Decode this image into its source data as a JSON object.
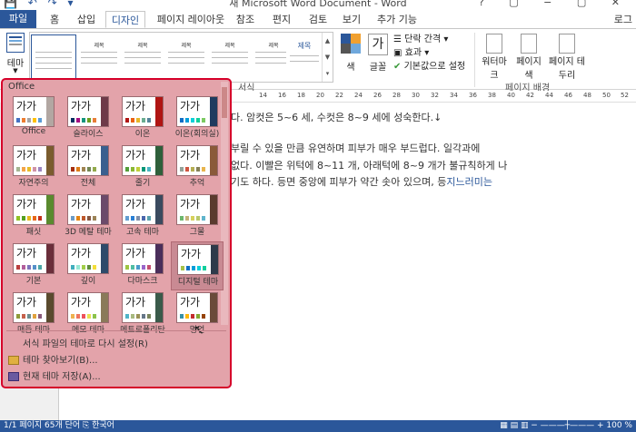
{
  "window": {
    "title": "새 Microsoft Word Document - Word",
    "qat": "💾 ↶ ↷ ▾",
    "controls": "? ▢ − ▢ ✕"
  },
  "tabs": {
    "file": "파일",
    "items": [
      "홈",
      "삽입",
      "디자인",
      "페이지 레이아웃",
      "참조",
      "편지",
      "검토",
      "보기",
      "추가 기능"
    ],
    "active": "디자인",
    "user": "로그"
  },
  "ribbon": {
    "theme_label": "테마",
    "doc_format_label": "서식",
    "style_thumbs": [
      {
        "name": ""
      },
      {
        "name": "제목"
      },
      {
        "name": "제목"
      },
      {
        "name": "제목"
      },
      {
        "name": "제목"
      },
      {
        "name": "제목"
      },
      {
        "name": "제목"
      }
    ],
    "colors_label": "색",
    "fonts_label": "글꼴",
    "paragraph_spacing": "단락 간격 ▾",
    "effects": "효과 ▾",
    "set_default": "기본값으로 설정",
    "watermark": "워터마크",
    "page_color": "페이지 색",
    "page_borders": "페이지 테두리",
    "page_background_label": "페이지 배경"
  },
  "ruler": {
    "numbers": [
      "14",
      "16",
      "18",
      "20",
      "22",
      "24",
      "26",
      "28",
      "30",
      "32",
      "34",
      "36",
      "38",
      "40",
      "42",
      "44",
      "46",
      "48",
      "50",
      "52"
    ]
  },
  "document": {
    "lines": [
      {
        "text": "다. 암컷은 5~6 세, 수컷은 8~9 세에 성숙한다.↓",
        "hl": ""
      },
      {
        "text": "부릴 수 있을 만큼 유연하며 피부가 매우 부드럽다. 일각과에",
        "hl": ""
      },
      {
        "text": "없다. 이빨은 위턱에 8~11 개, 아래턱에 8~9 개가 불규칙하게 나",
        "hl": ""
      },
      {
        "text": "기도 하다. 등면 중앙에 피부가 약간 솟아 있으며, 등",
        "hl": "지느러미는"
      }
    ]
  },
  "theme_panel": {
    "header": "Office",
    "themes": [
      {
        "name": "Office",
        "thumb": "가가",
        "side": "#b2a7a2",
        "colors": [
          "#4472c4",
          "#ed7d31",
          "#a5a5a5",
          "#ffc000",
          "#5b9bd5"
        ]
      },
      {
        "name": "슬라이스",
        "thumb": "가가",
        "side": "#6e3a49",
        "colors": [
          "#052f61",
          "#a50e82",
          "#14967c",
          "#6a9e1f",
          "#e87d37"
        ]
      },
      {
        "name": "이온",
        "thumb": "가가",
        "side": "#b01513",
        "colors": [
          "#b01513",
          "#ea6312",
          "#e6b729",
          "#6aac90",
          "#54849a"
        ]
      },
      {
        "name": "이온(회의실)",
        "thumb": "가가",
        "side": "#1f3a5f",
        "colors": [
          "#0f6fc6",
          "#009dd9",
          "#0bd0d9",
          "#10cf9b",
          "#7cca62"
        ]
      },
      {
        "name": "자연주의",
        "thumb": "가가",
        "side": "#7a5c2e",
        "colors": [
          "#a5b592",
          "#f3a447",
          "#e7bc29",
          "#d092a7",
          "#9c85c0"
        ]
      },
      {
        "name": "전체",
        "thumb": "가가",
        "side": "#3a5f8f",
        "colors": [
          "#a53010",
          "#de7e18",
          "#9f8351",
          "#728653",
          "#92aa4c"
        ]
      },
      {
        "name": "줄기",
        "thumb": "가가",
        "side": "#2e5f3a",
        "colors": [
          "#549e39",
          "#8ab833",
          "#c0cf3a",
          "#029676",
          "#4ab5c4"
        ]
      },
      {
        "name": "추억",
        "thumb": "가가",
        "side": "#8a5a3a",
        "colors": [
          "#93a299",
          "#cf543f",
          "#b5ae53",
          "#848058",
          "#e8b54d"
        ]
      },
      {
        "name": "패싯",
        "thumb": "가가",
        "side": "#5a8a2e",
        "colors": [
          "#90c226",
          "#54a021",
          "#e6b91e",
          "#e76618",
          "#c42f1a"
        ]
      },
      {
        "name": "3D 메탈 테마",
        "thumb": "가가",
        "side": "#6b4a6a",
        "colors": [
          "#6b9bc7",
          "#e48312",
          "#bd582c",
          "#865640",
          "#9b8357"
        ]
      },
      {
        "name": "고속 테마",
        "thumb": "가가",
        "side": "#3a4a5f",
        "colors": [
          "#629dd1",
          "#297fd5",
          "#7f8fa9",
          "#4a66ac",
          "#5aa2ae"
        ]
      },
      {
        "name": "그물",
        "thumb": "가가",
        "side": "#5a3a2e",
        "colors": [
          "#6bb76d",
          "#c6b178",
          "#d6d15c",
          "#b7c86b",
          "#60b5cc"
        ]
      },
      {
        "name": "기본",
        "thumb": "가가",
        "side": "#6a2e3a",
        "colors": [
          "#ba3f3f",
          "#b25e9c",
          "#7e74bc",
          "#5590c9",
          "#4ca6a6"
        ]
      },
      {
        "name": "깊이",
        "thumb": "가가",
        "side": "#2e4a6a",
        "colors": [
          "#41aebd",
          "#97e9d5",
          "#a2cf49",
          "#608f3d",
          "#f4de3a"
        ]
      },
      {
        "name": "다마스크",
        "thumb": "가가",
        "side": "#4a2e5a",
        "colors": [
          "#9ec544",
          "#50bea3",
          "#4a9ccc",
          "#9a66ca",
          "#c54f71"
        ]
      },
      {
        "name": "디지털 테마",
        "thumb": "가가",
        "side": "#2e3a4a",
        "colors": [
          "#a5c249",
          "#0f6fc6",
          "#009dd9",
          "#0bd0d9",
          "#10cf9b"
        ]
      },
      {
        "name": "매듭 테마",
        "thumb": "가가",
        "side": "#5a4a2e",
        "colors": [
          "#8f9a3a",
          "#c5614b",
          "#6b8e8f",
          "#e0a23e",
          "#8a5a7a"
        ]
      },
      {
        "name": "메모 테마",
        "thumb": "가가",
        "side": "#8a7a5a",
        "colors": [
          "#efb251",
          "#ef755f",
          "#ed515c",
          "#e8e152",
          "#8bc34a"
        ]
      },
      {
        "name": "메트로폴리탄",
        "thumb": "가가",
        "side": "#3a5a4a",
        "colors": [
          "#50b4c8",
          "#a8b97f",
          "#9b9256",
          "#657689",
          "#7a855d"
        ]
      },
      {
        "name": "명언",
        "thumb": "가가",
        "side": "#6a4a3a",
        "colors": [
          "#3891a7",
          "#feb80a",
          "#c32d2e",
          "#84aa33",
          "#964305"
        ]
      }
    ],
    "selected": "디지털 테마",
    "reset_cmd": "서식 파일의 테마로 다시 설정(R)",
    "browse_cmd": "테마 찾아보기(B)...",
    "save_cmd": "현재 테마 저장(A)..."
  },
  "status": {
    "left": "1/1 페이지   65개 단어   ⎘   한국어",
    "right": "▦  ▤  ▥  −  ———┼———  +  100 %"
  }
}
